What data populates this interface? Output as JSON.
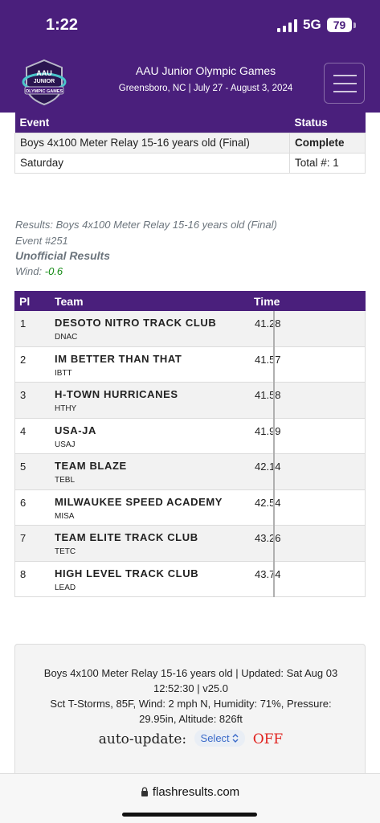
{
  "status_bar": {
    "time": "1:22",
    "network": "5G",
    "battery": "79"
  },
  "header": {
    "title": "AAU Junior Olympic Games",
    "subtitle": "Greensboro, NC | July 27 - August 3, 2024",
    "logo": {
      "line1": "AAU",
      "line2": "JUNIOR",
      "line3": "OLYMPIC GAMES"
    }
  },
  "event_table": {
    "col_event": "Event",
    "col_status": "Status",
    "event_name": "Boys 4x100 Meter Relay 15-16 years old (Final)",
    "status": "Complete",
    "day": "Saturday",
    "total": "Total #: 1"
  },
  "results_info": {
    "title": "Results: Boys 4x100 Meter Relay 15-16 years old (Final)",
    "event_number": "Event #251",
    "unofficial": "Unofficial Results",
    "wind_label": "Wind: ",
    "wind_value": "-0.6"
  },
  "results": {
    "headers": {
      "place": "Pl",
      "team": "Team",
      "time": "Time"
    },
    "rows": [
      {
        "place": "1",
        "team": "DESOTO NITRO TRACK CLUB",
        "abbr": "DNAC",
        "time": "41.28"
      },
      {
        "place": "2",
        "team": "IM BETTER THAN THAT",
        "abbr": "IBTT",
        "time": "41.57"
      },
      {
        "place": "3",
        "team": "H-TOWN HURRICANES",
        "abbr": "HTHY",
        "time": "41.58"
      },
      {
        "place": "4",
        "team": "USA-JA",
        "abbr": "USAJ",
        "time": "41.99"
      },
      {
        "place": "5",
        "team": "TEAM BLAZE",
        "abbr": "TEBL",
        "time": "42.14"
      },
      {
        "place": "6",
        "team": "MILWAUKEE SPEED ACADEMY",
        "abbr": "MISA",
        "time": "42.54"
      },
      {
        "place": "7",
        "team": "TEAM ELITE TRACK CLUB",
        "abbr": "TETC",
        "time": "43.26"
      },
      {
        "place": "8",
        "team": "HIGH LEVEL TRACK CLUB",
        "abbr": "LEAD",
        "time": "43.74"
      }
    ]
  },
  "footer": {
    "line1": "Boys 4x100 Meter Relay 15-16 years old | Updated: Sat Aug 03",
    "line2": "12:52:30 | v25.0",
    "line3": "Sct T-Storms, 85F, Wind: 2 mph N, Humidity: 71%, Pressure:",
    "line4": "29.95in, Altitude: 826ft",
    "auto_update_label": "auto-update:",
    "select_value": "Select",
    "auto_update_state": "OFF"
  },
  "browser": {
    "url": "flashresults.com"
  },
  "colors": {
    "brand_purple": "#4a1f7c",
    "wind_green": "#138a13",
    "off_red": "#e0201c"
  },
  "icons": [
    "signal-icon",
    "battery-icon",
    "menu-icon",
    "lock-icon",
    "select-chevron-icon"
  ]
}
